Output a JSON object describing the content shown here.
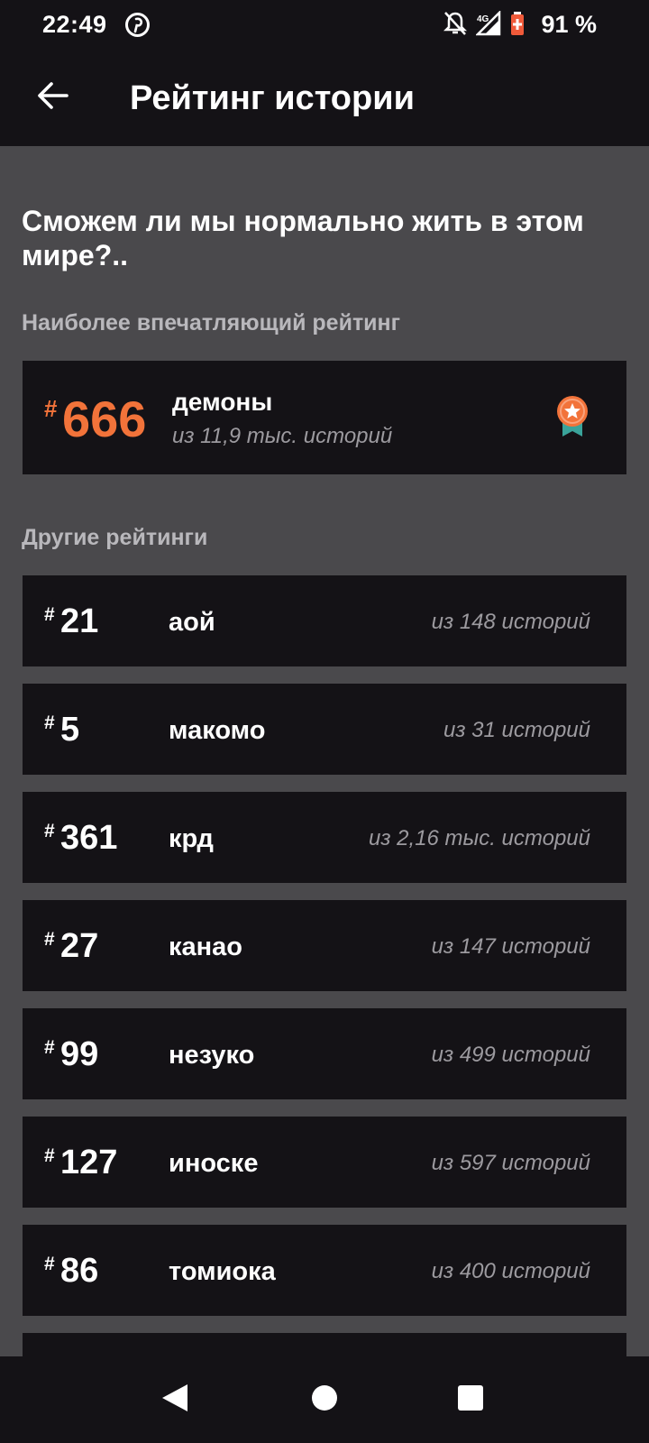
{
  "status_bar": {
    "time": "22:49",
    "battery": "91 %",
    "network": "4G",
    "icons": [
      "pinterest-icon",
      "notifications-off-icon",
      "signal-icon",
      "battery-icon"
    ]
  },
  "app_bar": {
    "title": "Рейтинг истории",
    "back_icon": "arrow-left-icon"
  },
  "story": {
    "title": "Сможем ли мы нормально жить в этом мире?.."
  },
  "best_rating": {
    "section_label": "Наиболее впечатляющий рейтинг",
    "hash": "#",
    "rank": "666",
    "tag": "демоны",
    "out_of": "из 11,9 тыс. историй",
    "icon": "medal-icon",
    "accent_color": "#f2733a"
  },
  "other_ratings": {
    "section_label": "Другие рейтинги",
    "items": [
      {
        "hash": "#",
        "rank": "21",
        "tag": "аой",
        "out_of": "из 148 историй"
      },
      {
        "hash": "#",
        "rank": "5",
        "tag": "макомо",
        "out_of": "из 31 историй"
      },
      {
        "hash": "#",
        "rank": "361",
        "tag": "крд",
        "out_of": "из 2,16 тыс. историй"
      },
      {
        "hash": "#",
        "rank": "27",
        "tag": "канао",
        "out_of": "из 147 историй"
      },
      {
        "hash": "#",
        "rank": "99",
        "tag": "незуко",
        "out_of": "из 499 историй"
      },
      {
        "hash": "#",
        "rank": "127",
        "tag": "иноске",
        "out_of": "из 597 историй"
      },
      {
        "hash": "#",
        "rank": "86",
        "tag": "томиока",
        "out_of": "из 400 историй"
      }
    ]
  },
  "nav_bar": {
    "buttons": [
      "back-triangle-icon",
      "home-circle-icon",
      "recents-square-icon"
    ]
  }
}
